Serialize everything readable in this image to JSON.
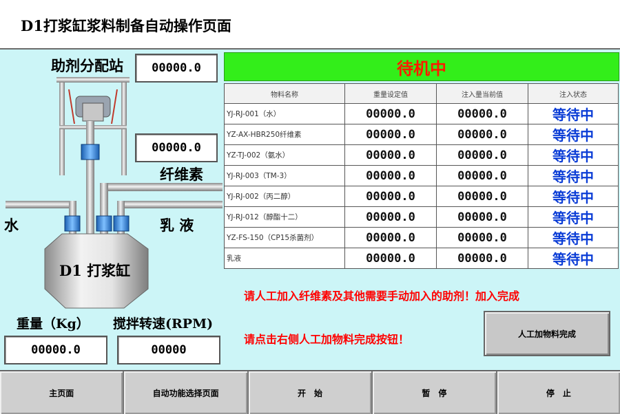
{
  "header": {
    "title": "D1打浆缸浆料制备自动操作页面"
  },
  "diagram": {
    "station_label": "助剂分配站",
    "station_value": "00000.0",
    "fiber_label": "纤维素",
    "fiber_value": "00000.0",
    "water_label": "水",
    "emulsion_label": "乳 液",
    "tank_label": "D1 打浆缸"
  },
  "readouts": {
    "weight_label": "重量（Kg）",
    "weight_value": "00000.0",
    "speed_label": "搅拌转速(RPM)",
    "speed_value": "00000"
  },
  "status": {
    "text": "待机中",
    "bg_color": "#33ee1a",
    "text_color": "#ff1a00"
  },
  "table": {
    "headers": [
      "物料名称",
      "重量设定值",
      "注入量当前值",
      "注入状态"
    ],
    "rows": [
      {
        "name": "YJ-RJ-001（水）",
        "setpoint": "00000.0",
        "current": "00000.0",
        "state": "等待中"
      },
      {
        "name": "YZ-AX-HBR250纤维素",
        "setpoint": "00000.0",
        "current": "00000.0",
        "state": "等待中"
      },
      {
        "name": "YZ-TJ-002（氨水）",
        "setpoint": "00000.0",
        "current": "00000.0",
        "state": "等待中"
      },
      {
        "name": "YJ-RJ-003（TM-3）",
        "setpoint": "00000.0",
        "current": "00000.0",
        "state": "等待中"
      },
      {
        "name": "YJ-RJ-002（丙二醇）",
        "setpoint": "00000.0",
        "current": "00000.0",
        "state": "等待中"
      },
      {
        "name": "YJ-RJ-012（醇酯十二）",
        "setpoint": "00000.0",
        "current": "00000.0",
        "state": "等待中"
      },
      {
        "name": "YZ-FS-150（CP15杀菌剂）",
        "setpoint": "00000.0",
        "current": "00000.0",
        "state": "等待中"
      },
      {
        "name": "乳液",
        "setpoint": "00000.0",
        "current": "00000.0",
        "state": "等待中"
      }
    ]
  },
  "messages": {
    "line1": "请人工加入纤维素及其他需要手动加入的助剂！加入完成",
    "line2": "请点击右侧人工加物料完成按钮！"
  },
  "manual_done_button": "人工加物料完成",
  "nav": {
    "home": "主页面",
    "auto_select": "自动功能选择页面",
    "start": "开　始",
    "pause": "暂　停",
    "stop": "停　止"
  },
  "colors": {
    "panel_bg": "#ccf5f7",
    "status_blue": "#0a3cd6",
    "warning_red": "#ff0000"
  }
}
